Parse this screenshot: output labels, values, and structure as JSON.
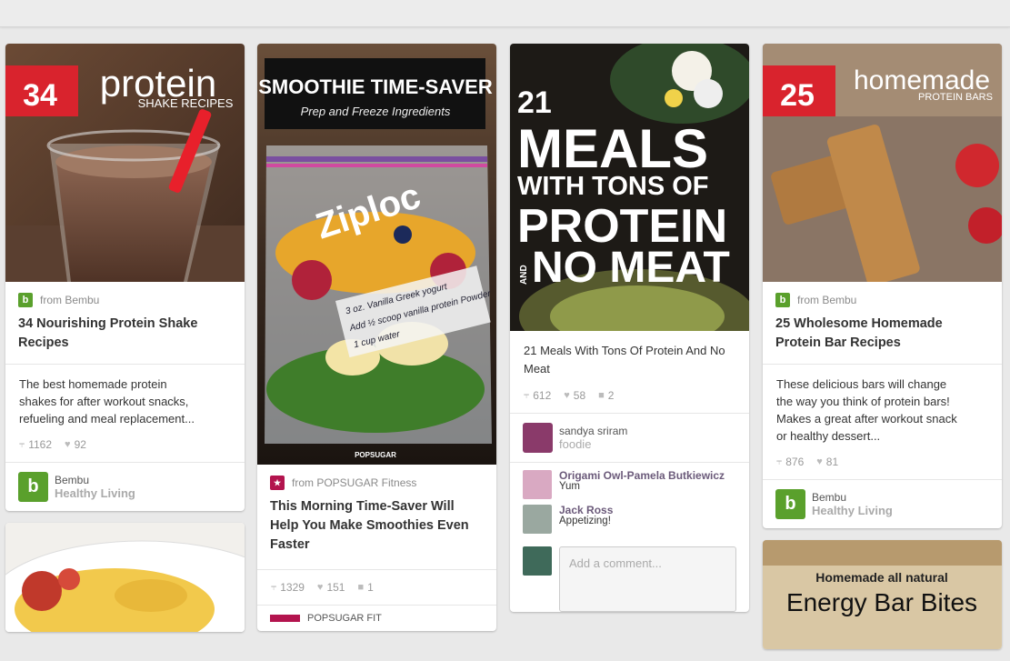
{
  "columns": [
    {
      "pins": [
        {
          "image_text": {
            "badge": "34",
            "headline": "protein",
            "sub": "SHAKE RECIPES"
          },
          "source": "from Bembu",
          "title": "34 Nourishing Protein Shake Recipes",
          "description": [
            "The best homemade protein",
            "shakes for after workout snacks,",
            "refueling and meal replacement..."
          ],
          "repins": "1162",
          "likes": "92",
          "owner": {
            "name": "Bembu",
            "board": "Healthy Living",
            "avatar_letter": "b"
          }
        }
      ]
    },
    {
      "pins": [
        {
          "image_text": {
            "banner_title": "SMOOTHIE TIME-SAVER",
            "banner_sub": "Prep and Freeze Ingredients",
            "bag_label": "Ziploc",
            "note_line1": "3 oz. Vanilla Greek yogurt",
            "note_line2": "Add ½ scoop vanilla protein Powder",
            "note_line3": "1 cup water",
            "watermark": "POPSUGAR"
          },
          "source": "from POPSUGAR Fitness",
          "title": "This Morning Time-Saver Will Help You Make Smoothies Even Faster",
          "repins": "1329",
          "likes": "151",
          "comments": "1"
        }
      ]
    },
    {
      "pins": [
        {
          "image_text": {
            "l1": "21",
            "l2": "MEALS",
            "l3": "WITH TONS OF",
            "l4": "PROTEIN",
            "l5_small": "AND",
            "l5": "NO MEAT"
          },
          "title": "21 Meals With Tons Of Protein And No Meat",
          "repins": "612",
          "likes": "58",
          "comments": "2",
          "pinner": {
            "name": "sandya sriram",
            "board": "foodie"
          },
          "comment_list": [
            {
              "author": "Origami Owl-Pamela Butkiewicz",
              "text": "Yum"
            },
            {
              "author": "Jack Ross",
              "text": "Appetizing!"
            }
          ],
          "comment_placeholder": "Add a comment..."
        }
      ]
    },
    {
      "pins": [
        {
          "image_text": {
            "badge": "25",
            "headline": "homemade",
            "sub": "PROTEIN BARS"
          },
          "source": "from Bembu",
          "title": "25 Wholesome Homemade Protein Bar Recipes",
          "description": [
            "These delicious bars will change",
            "the way you think of protein bars!",
            "Makes a great after workout snack",
            "or healthy dessert..."
          ],
          "repins": "876",
          "likes": "81",
          "owner": {
            "name": "Bembu",
            "board": "Healthy Living",
            "avatar_letter": "b"
          }
        },
        {
          "image_text": {
            "line1": "Homemade all natural",
            "line2": "Energy Bar Bites"
          }
        }
      ]
    }
  ],
  "partial_labels": {
    "col2_next_source": "POPSUGAR FIT"
  },
  "icons": {
    "repin": "pin-icon",
    "like": "heart-icon",
    "comment": "comment-icon",
    "source": "bembu-logo-icon"
  },
  "colors": {
    "badge_red": "#d9232d",
    "bembu_green": "#5aa02c",
    "popsugar_pink": "#b3144e",
    "page_bg": "#e9e9e9"
  }
}
